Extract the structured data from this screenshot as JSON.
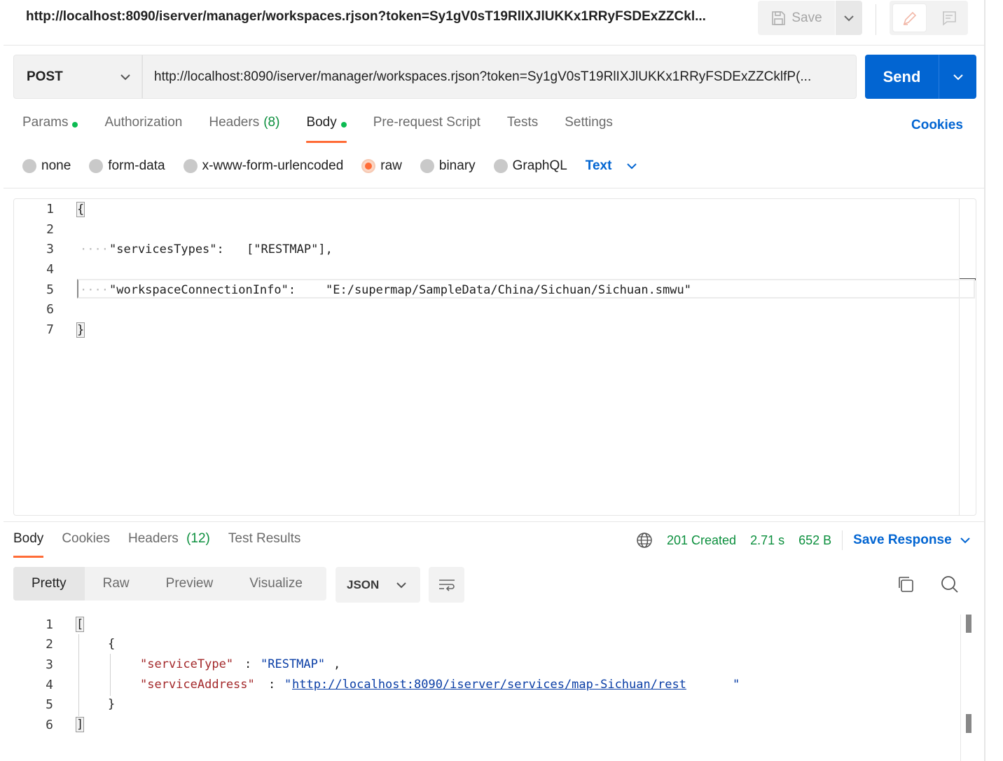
{
  "header": {
    "title_url": "http://localhost:8090/iserver/manager/workspaces.rjson?token=Sy1gV0sT19RlIXJlUKKx1RRyFSDExZZCkl...",
    "save_label": "Save"
  },
  "request": {
    "method": "POST",
    "url": "http://localhost:8090/iserver/manager/workspaces.rjson?token=Sy1gV0sT19RlIXJlUKKx1RRyFSDExZZCklfP(...",
    "send_label": "Send"
  },
  "request_tabs": {
    "params": "Params",
    "authorization": "Authorization",
    "headers": "Headers",
    "headers_count": "(8)",
    "body": "Body",
    "pre_request": "Pre-request Script",
    "tests": "Tests",
    "settings": "Settings",
    "cookies": "Cookies"
  },
  "body_types": {
    "none": "none",
    "form_data": "form-data",
    "urlencoded": "x-www-form-urlencoded",
    "raw": "raw",
    "binary": "binary",
    "graphql": "GraphQL",
    "selected_format": "Text"
  },
  "request_body": {
    "line_numbers": [
      "1",
      "2",
      "3",
      "4",
      "5",
      "6",
      "7"
    ],
    "open_brace": "{",
    "key1": "\"servicesTypes\":",
    "val1": "[\"RESTMAP\"],",
    "key2": "\"workspaceConnectionInfo\":",
    "val2": "\"E:/supermap/SampleData/China/Sichuan/Sichuan.smwu\"",
    "close_brace": "}"
  },
  "response_tabs": {
    "body": "Body",
    "cookies": "Cookies",
    "headers": "Headers",
    "headers_count": "(12)",
    "test_results": "Test Results"
  },
  "response_meta": {
    "status": "201 Created",
    "time": "2.71 s",
    "size": "652 B",
    "save_response": "Save Response"
  },
  "view_modes": {
    "pretty": "Pretty",
    "raw": "Raw",
    "preview": "Preview",
    "visualize": "Visualize",
    "format": "JSON"
  },
  "response_body": {
    "line_numbers": [
      "1",
      "2",
      "3",
      "4",
      "5",
      "6"
    ],
    "open_bracket": "[",
    "open_brace": "{",
    "key1": "\"serviceType\"",
    "val1": "\"RESTMAP\"",
    "key2": "\"serviceAddress\"",
    "val2_quote_open": "\"",
    "val2_link": "http://localhost:8090/iserver/services/map-Sichuan/rest",
    "val2_quote_close": "\"",
    "close_brace": "}",
    "close_bracket": "]"
  },
  "colors": {
    "accent_orange": "#ff6c37",
    "send_blue": "#0265d2",
    "status_green": "#0b8f3d"
  }
}
